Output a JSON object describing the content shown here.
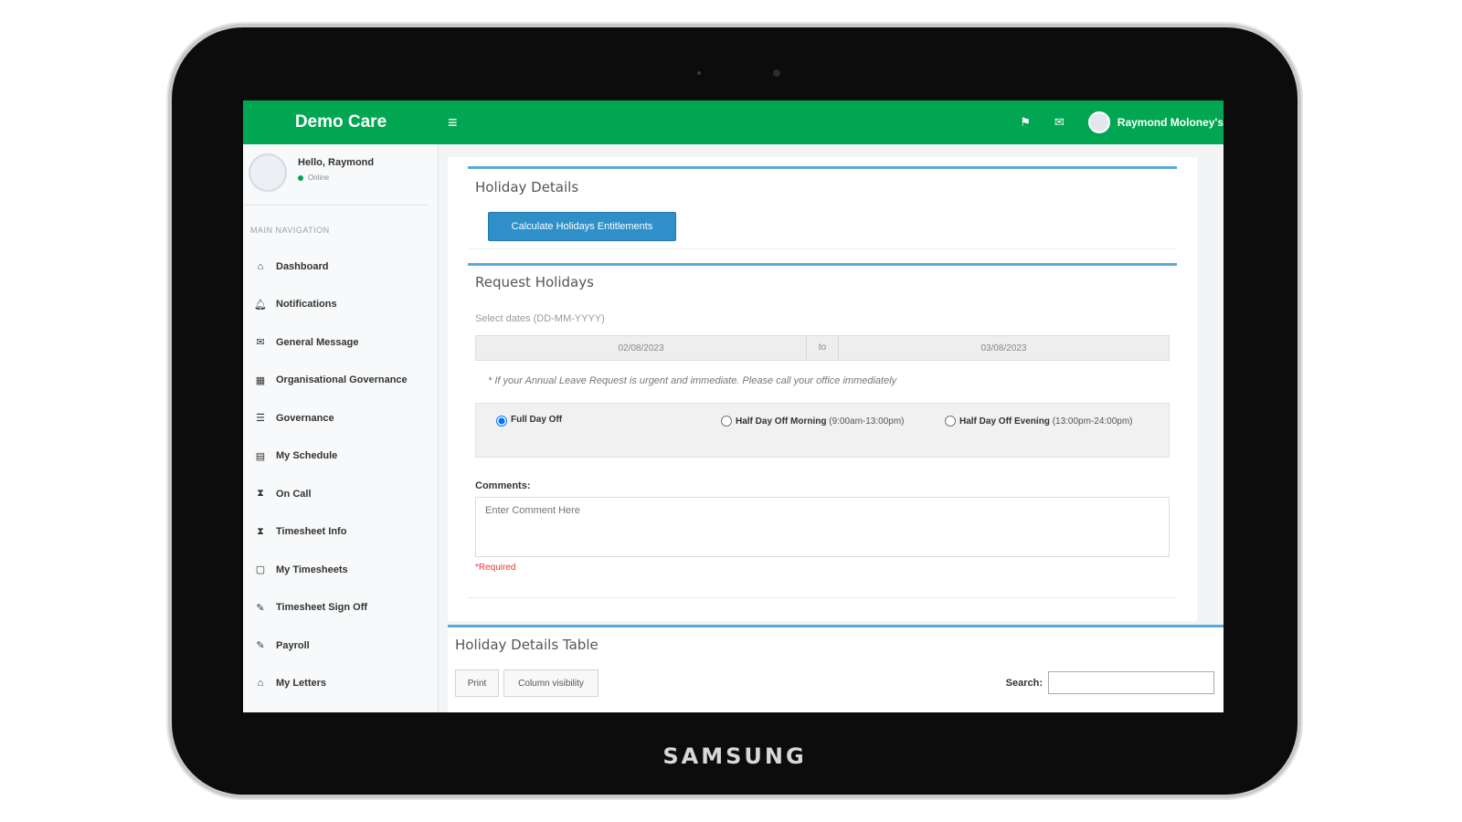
{
  "device": {
    "brand": "SAMSUNG"
  },
  "topbar": {
    "logo": "Demo Care",
    "menu_icon": "≡",
    "flag_icon": "⚑",
    "mail_icon": "✉",
    "user_name": "Raymond Moloney's",
    "bg_color": "#00a651"
  },
  "sidebar": {
    "greeting": "Hello, Raymond",
    "status": "Online",
    "nav_header": "MAIN NAVIGATION",
    "items": [
      {
        "label": "Dashboard",
        "icon": "dashboard-icon",
        "glyph": "⌂"
      },
      {
        "label": "Notifications",
        "icon": "bell-icon",
        "glyph": "🔔︎"
      },
      {
        "label": "General Message",
        "icon": "envelope-icon",
        "glyph": "✉"
      },
      {
        "label": "Organisational Governance",
        "icon": "table-icon",
        "glyph": "▦"
      },
      {
        "label": "Governance",
        "icon": "list-icon",
        "glyph": "☰"
      },
      {
        "label": "My Schedule",
        "icon": "calendar-icon",
        "glyph": "▤"
      },
      {
        "label": "On Call",
        "icon": "hourglass-icon",
        "glyph": "⧗"
      },
      {
        "label": "Timesheet Info",
        "icon": "hourglass-icon",
        "glyph": "⧗"
      },
      {
        "label": "My Timesheets",
        "icon": "calendar-icon",
        "glyph": "▢"
      },
      {
        "label": "Timesheet Sign Off",
        "icon": "pencil-icon",
        "glyph": "✎"
      },
      {
        "label": "Payroll",
        "icon": "pencil-icon",
        "glyph": "✎"
      },
      {
        "label": "My Letters",
        "icon": "letters-icon",
        "glyph": "⌂"
      }
    ]
  },
  "holiday_details": {
    "title": "Holiday Details",
    "calc_button": "Calculate Holidays Entitlements"
  },
  "request_holidays": {
    "title": "Request Holidays",
    "dates_label": "Select dates (DD-MM-YYYY)",
    "date_from": "02/08/2023",
    "to_label": "to",
    "date_to": "03/08/2023",
    "note": "* If your Annual Leave Request is urgent and immediate. Please call your office immediately",
    "options": [
      {
        "label": "Full Day Off",
        "sub": "",
        "checked": true
      },
      {
        "label": "Half Day Off Morning",
        "sub": "(9:00am-13:00pm)",
        "checked": false
      },
      {
        "label": "Half Day Off Evening",
        "sub": "(13:00pm-24:00pm)",
        "checked": false
      }
    ],
    "comments_label": "Comments:",
    "comments_placeholder": "Enter Comment Here",
    "required": "*Required"
  },
  "holiday_table": {
    "title": "Holiday Details Table",
    "print_button": "Print",
    "column_button": "Column visibility",
    "search_label": "Search:"
  }
}
